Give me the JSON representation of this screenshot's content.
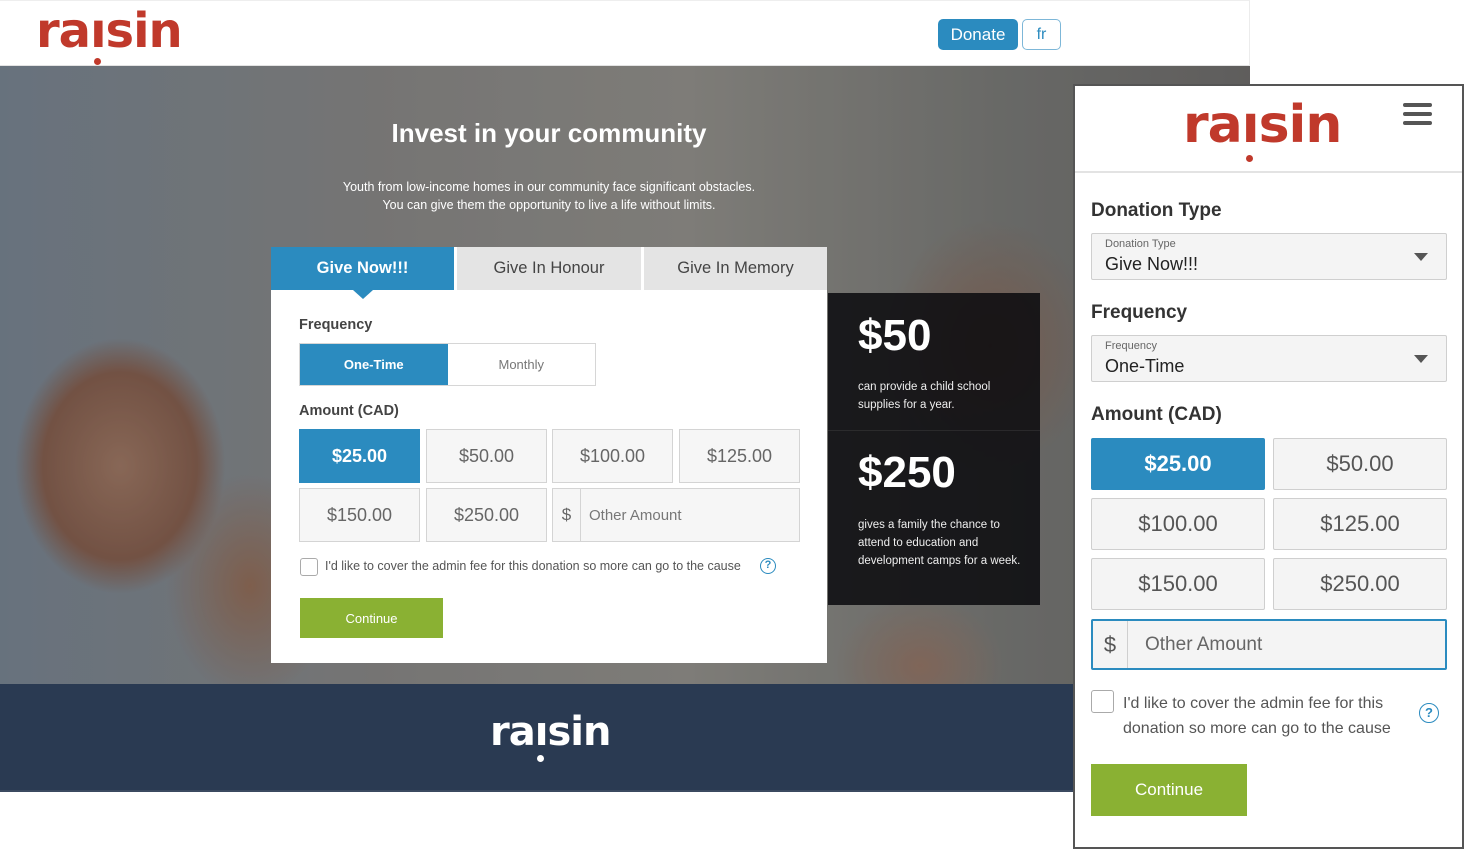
{
  "brand": {
    "logo_text": "raisin",
    "logo_color": "#c0392b",
    "accent": "#2b8bbf",
    "cta": "#8ab133",
    "footer_bg": "#2a3a52"
  },
  "desktop": {
    "header": {
      "donate_label": "Donate",
      "lang_label": "fr"
    },
    "hero": {
      "title": "Invest in your community",
      "subtitle_line1": "Youth from low-income homes in our community face significant obstacles.",
      "subtitle_line2": "You can give them the opportunity to live a life without limits."
    },
    "tabs": [
      {
        "label": "Give Now!!!",
        "active": true
      },
      {
        "label": "Give In Honour",
        "active": false
      },
      {
        "label": "Give In Memory",
        "active": false
      }
    ],
    "frequency": {
      "label": "Frequency",
      "options": [
        {
          "label": "One-Time",
          "active": true
        },
        {
          "label": "Monthly",
          "active": false
        }
      ]
    },
    "amount": {
      "label": "Amount (CAD)",
      "options": [
        {
          "label": "$25.00",
          "active": true
        },
        {
          "label": "$50.00",
          "active": false
        },
        {
          "label": "$100.00",
          "active": false
        },
        {
          "label": "$125.00",
          "active": false
        },
        {
          "label": "$150.00",
          "active": false
        },
        {
          "label": "$250.00",
          "active": false
        }
      ],
      "other_currency": "$",
      "other_placeholder": "Other Amount",
      "other_value": ""
    },
    "admin_fee": {
      "label": "I'd like to cover the admin fee for this donation so more can go to the cause",
      "checked": false,
      "help_glyph": "?"
    },
    "continue_label": "Continue",
    "impact": [
      {
        "amount": "$50",
        "text": "can provide a child school supplies for a year."
      },
      {
        "amount": "$250",
        "text": "gives a family the chance to attend to education and development camps for a week."
      }
    ],
    "footer": {
      "logo_text": "raisin"
    }
  },
  "mobile": {
    "donation_type": {
      "heading": "Donation Type",
      "field_label": "Donation Type",
      "value": "Give Now!!!"
    },
    "frequency": {
      "heading": "Frequency",
      "field_label": "Frequency",
      "value": "One-Time"
    },
    "amount": {
      "heading": "Amount (CAD)",
      "options": [
        {
          "label": "$25.00",
          "active": true
        },
        {
          "label": "$50.00",
          "active": false
        },
        {
          "label": "$100.00",
          "active": false
        },
        {
          "label": "$125.00",
          "active": false
        },
        {
          "label": "$150.00",
          "active": false
        },
        {
          "label": "$250.00",
          "active": false
        }
      ],
      "other_currency": "$",
      "other_placeholder": "Other Amount"
    },
    "admin_fee": {
      "line1": "I'd like to cover the admin fee for this",
      "line2": "donation so more can go to the cause",
      "checked": false,
      "help_glyph": "?"
    },
    "continue_label": "Continue"
  }
}
